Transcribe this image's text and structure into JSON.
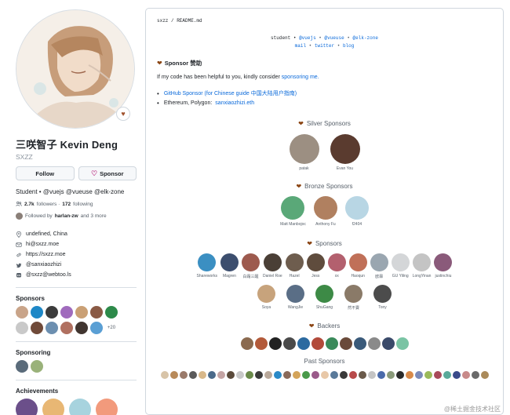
{
  "profile": {
    "avatar_alt": "Kevin Deng avatar",
    "fullname": "三咲智子 Kevin Deng",
    "username": "SXZZ",
    "follow_label": "Follow",
    "sponsor_label": "Sponsor",
    "bio": "Student • @vuejs @vueuse @elk-zone",
    "followers_count": "2.7k",
    "followers_label": "followers ·",
    "following_count": "172",
    "following_label": "following",
    "followed_by_prefix": "Followed by",
    "followed_by_user": "harlan-zw",
    "followed_by_suffix": "and 3 more",
    "location": "undefined, China",
    "email": "hi@sxzz.moe",
    "website": "https://sxzz.moe",
    "twitter": "@sanxiaozhizi",
    "mastodon": "@sxzz@webtoo.ls"
  },
  "sections": {
    "sponsors_title": "Sponsors",
    "sponsors_more": "+20",
    "sponsoring_title": "Sponsoring",
    "achievements_title": "Achievements"
  },
  "sidebar_sponsor_colors": [
    "#c9a489",
    "#1e88c7",
    "#3c3c3c",
    "#a06bbd",
    "#caa075",
    "#8a5a45",
    "#2d8a4a",
    "#c9c9c9",
    "#704a39",
    "#6c8fb0",
    "#b07060",
    "#413530",
    "#5a9fd4"
  ],
  "sponsoring_colors": [
    "#5a6b7a",
    "#9ab27a"
  ],
  "achievement_colors": [
    "#6b4f8a",
    "#e8b774",
    "#a7d3de",
    "#f29a7c"
  ],
  "readme": {
    "path": "sxzz / README.md",
    "intro_label": "student •",
    "org1": "@vuejs",
    "org2": "@vueuse",
    "org3": "@elk-zone",
    "link_mail": "mail",
    "link_twitter": "twitter",
    "link_blog": "blog",
    "sponsor_heading": "Sponsor 赞助",
    "sponsor_text_prefix": "If my code has been helpful to you, kindly consider",
    "sponsor_text_link": "sponsoring me.",
    "list_item1": "GitHub Sponsor (for Chinese guide 中国大陆用户指南)",
    "list_item2_prefix": "Ethereum, Polygon:",
    "list_item2_link": "sanxiaozhizi.eth",
    "silver_title": "Silver Sponsors",
    "bronze_title": "Bronze Sponsors",
    "sponsors_title": "Sponsors",
    "backers_title": "Backers",
    "past_title": "Past Sponsors"
  },
  "silver": [
    {
      "name": "patak",
      "color": "#9c8f82"
    },
    {
      "name": "Evan You",
      "color": "#5a3b2f"
    }
  ],
  "bronze": [
    {
      "name": "Matt Manbojoc",
      "color": "#5aa878"
    },
    {
      "name": "Anthony Fu",
      "color": "#b08060"
    },
    {
      "name": "f2404",
      "color": "#b8d6e4"
    }
  ],
  "sponsors_row1": [
    {
      "name": "Shareworks",
      "color": "#3b8fc2"
    },
    {
      "name": "Magren",
      "color": "#3c4e6e"
    },
    {
      "name": "白霜三醒",
      "color": "#9d5a4e"
    },
    {
      "name": "Daniel Roe",
      "color": "#4a3f36"
    },
    {
      "name": "Hazel",
      "color": "#6e5d4e"
    },
    {
      "name": "Jess",
      "color": "#5f4c3d"
    },
    {
      "name": "xx",
      "color": "#b3606e"
    },
    {
      "name": "Haoqun",
      "color": "#c07058"
    },
    {
      "name": "欧霖",
      "color": "#9aa6b0"
    },
    {
      "name": "GU Yiling",
      "color": "#d4d6d8"
    },
    {
      "name": "LongYinan",
      "color": "#c4c4c4"
    },
    {
      "name": "justinchiu",
      "color": "#8a5a7a"
    }
  ],
  "sponsors_row2": [
    {
      "name": "Soya",
      "color": "#c7a37c"
    },
    {
      "name": "WangJie",
      "color": "#5a6e86"
    },
    {
      "name": "ShuGang",
      "color": "#3d8a46"
    },
    {
      "name": "然不賣",
      "color": "#8a7a68"
    },
    {
      "name": "Tony",
      "color": "#4c4c4c"
    }
  ],
  "backers": [
    "#8b6a4f",
    "#b35a3a",
    "#222",
    "#4a4a4a",
    "#2c6aa0",
    "#b24a3a",
    "#3a8a5a",
    "#6a4a3a",
    "#3a5a7a",
    "#8a8a8a",
    "#3a4a6a",
    "#7ac4a4"
  ],
  "past": [
    "#d8c4a8",
    "#b88a5a",
    "#9a7a6a",
    "#5a5a5a",
    "#d8b88a",
    "#4a6a8a",
    "#c4a4a4",
    "#5a4a3a",
    "#c8c8c8",
    "#6a8a4a",
    "#3a3a3a",
    "#b8a89a",
    "#2a8ac8",
    "#8a6a5a",
    "#d4a45a",
    "#4a9a4a",
    "#9a5a8a",
    "#e8c8a8",
    "#5a7a9a",
    "#3a3a3a",
    "#b84a4a",
    "#6a5a4a",
    "#c4c4c4",
    "#4a6aaa",
    "#8a9a7a",
    "#2a2a2a",
    "#d88a4a",
    "#7a8aba",
    "#9aba5a",
    "#a84a5a",
    "#5aaa9a",
    "#3a4a8a",
    "#c88a8a",
    "#6a6a6a",
    "#aa8a5a"
  ],
  "watermark": "@稀土掘金技术社区"
}
